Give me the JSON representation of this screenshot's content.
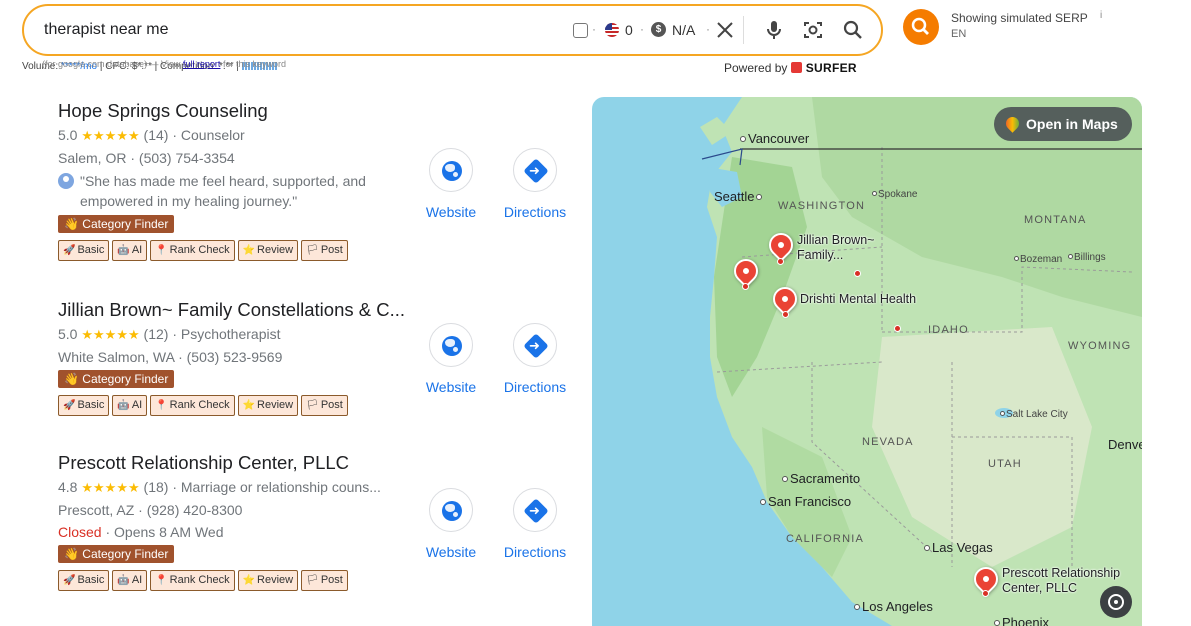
{
  "search": {
    "query": "therapist near me",
    "count": "0",
    "cpc_value": "N/A"
  },
  "serp": {
    "title": "Showing simulated SERP",
    "info_icon": "i",
    "lang": "EN"
  },
  "metrics": {
    "line_prefix": "Volume: ",
    "volume": "*****/mo",
    "cpc": " | CPC: $*.** | Competition: *.** | ",
    "overlay_text": "(for google.com database) — View ",
    "full_report": "full report",
    "overlay_suffix": " for this keyword"
  },
  "powered": {
    "prefix": "Powered by",
    "brand": "SURFER"
  },
  "results": [
    {
      "title": "Hope Springs Counseling",
      "rating": "5.0",
      "stars": "★★★★★",
      "reviews": "(14)",
      "category": "· Counselor",
      "location": "Salem, OR · (503) 754-3354",
      "review": "\"She has made me feel heard, supported, and empowered in my healing journey.\"",
      "website": "Website",
      "directions": "Directions"
    },
    {
      "title": "Jillian Brown~ Family Constellations & C...",
      "rating": "5.0",
      "stars": "★★★★★",
      "reviews": "(12)",
      "category": "· Psychotherapist",
      "location": "White Salmon, WA · (503) 523-9569",
      "website": "Website",
      "directions": "Directions"
    },
    {
      "title": "Prescott Relationship Center, PLLC",
      "rating": "4.8",
      "stars": "★★★★★",
      "reviews": "(18)",
      "category": "· Marriage or relationship couns...",
      "location": "Prescott, AZ · (928) 420-8300",
      "status": "Closed",
      "hours": " · Opens 8 AM Wed",
      "website": "Website",
      "directions": "Directions"
    }
  ],
  "tools": {
    "category_finder": "Category Finder",
    "basic": "Basic",
    "ai": "AI",
    "rank_check": "Rank Check",
    "review": "Review",
    "post": "Post"
  },
  "map": {
    "open_maps": "Open in Maps",
    "cities": {
      "vancouver": "Vancouver",
      "seattle": "Seattle",
      "spokane": "Spokane",
      "bozeman": "Bozeman",
      "billings": "Billings",
      "salt_lake": "Salt Lake City",
      "sacramento": "Sacramento",
      "san_francisco": "San Francisco",
      "las_vegas": "Las Vegas",
      "los_angeles": "Los Angeles",
      "phoenix": "Phoenix",
      "denver": "Denve"
    },
    "states": {
      "washington": "WASHINGTON",
      "montana": "MONTANA",
      "idaho": "IDAHO",
      "wyoming": "WYOMING",
      "nevada": "NEVADA",
      "utah": "UTAH",
      "california": "CALIFORNIA"
    },
    "pins": {
      "jillian": "Jillian Brown~\nFamily...",
      "drishti": "Drishti Mental Health",
      "prescott": "Prescott Relationship\nCenter, PLLC"
    }
  }
}
